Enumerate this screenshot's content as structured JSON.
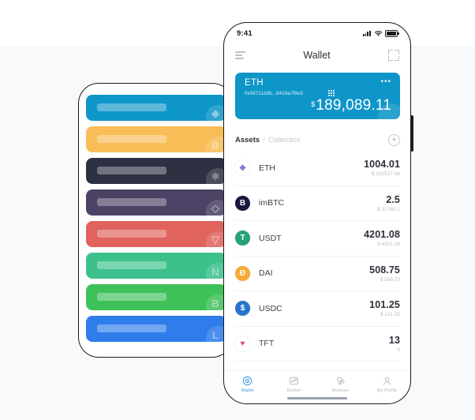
{
  "left_phone": {
    "name": "token-card-list-phone",
    "cards": [
      {
        "token": "ETH",
        "color": "#0f96c8",
        "watermark": "eth-diamond-icon"
      },
      {
        "token": "BTC",
        "color": "#f9bd58",
        "watermark": "bitcoin-b-icon"
      },
      {
        "token": "ATOM",
        "color": "#2e3142",
        "watermark": "cosmos-atom-icon"
      },
      {
        "token": "EOS",
        "color": "#4b4266",
        "watermark": "eos-drop-icon"
      },
      {
        "token": "TRX",
        "color": "#e0635e",
        "watermark": "tron-triangle-icon"
      },
      {
        "token": "NAS",
        "color": "#3dc18c",
        "watermark": "nebulas-n-icon"
      },
      {
        "token": "BCH",
        "color": "#3fc15a",
        "watermark": "bitcoin-cash-b-icon"
      },
      {
        "token": "LTC",
        "color": "#2f7ceb",
        "watermark": "litecoin-l-icon"
      }
    ]
  },
  "right_phone": {
    "status_bar": {
      "time": "9:41",
      "signal_icon": "cellular-signal-icon",
      "wifi_icon": "wifi-icon",
      "battery_icon": "battery-full-icon"
    },
    "nav_bar": {
      "menu_icon": "hamburger-menu-icon",
      "title": "Wallet",
      "scan_icon": "scan-qr-icon"
    },
    "wallet_card": {
      "symbol": "ETH",
      "address": "0x08711d3b...8418a7f8e3",
      "qr_icon": "qr-code-icon",
      "more_icon": "more-dots-icon",
      "currency_symbol": "$",
      "balance": "189,089.11",
      "bg_color": "#0f96c8"
    },
    "section_tabs": {
      "active": "Assets",
      "separator": "/",
      "inactive": "Collectics",
      "add_icon": "plus-circle-icon"
    },
    "assets": [
      {
        "symbol": "ETH",
        "icon": "ethereum-icon",
        "icon_color": "#ffffff",
        "icon_text_color": "#7b83cc",
        "glyph": "◆",
        "quantity": "1004.01",
        "fiat": "$ 162517.48"
      },
      {
        "symbol": "imBTC",
        "icon": "imbtc-icon",
        "icon_color": "#17183b",
        "icon_text_color": "#ffffff",
        "glyph": "B",
        "quantity": "2.5",
        "fiat": "$ 21760.1"
      },
      {
        "symbol": "USDT",
        "icon": "tether-icon",
        "icon_color": "#26a17b",
        "icon_text_color": "#ffffff",
        "glyph": "T",
        "quantity": "4201.08",
        "fiat": "$ 4201.08"
      },
      {
        "symbol": "DAI",
        "icon": "dai-icon",
        "icon_color": "#f5ac37",
        "icon_text_color": "#ffffff",
        "glyph": "Ð",
        "quantity": "508.75",
        "fiat": "$ 508.75"
      },
      {
        "symbol": "USDC",
        "icon": "usdc-icon",
        "icon_color": "#2775ca",
        "icon_text_color": "#ffffff",
        "glyph": "$",
        "quantity": "101.25",
        "fiat": "$ 101.25"
      },
      {
        "symbol": "TFT",
        "icon": "tft-icon",
        "icon_color": "#ffffff",
        "icon_text_color": "#e8486b",
        "glyph": "♥",
        "quantity": "13",
        "fiat": "0"
      }
    ],
    "tab_bar": {
      "active_color": "#3b9ae1",
      "items": [
        {
          "label": "Wallet",
          "icon": "wallet-target-icon",
          "active": true
        },
        {
          "label": "Market",
          "icon": "market-chart-icon",
          "active": false
        },
        {
          "label": "Browser",
          "icon": "browser-nodes-icon",
          "active": false
        },
        {
          "label": "My Profile",
          "icon": "user-profile-icon",
          "active": false
        }
      ]
    }
  }
}
